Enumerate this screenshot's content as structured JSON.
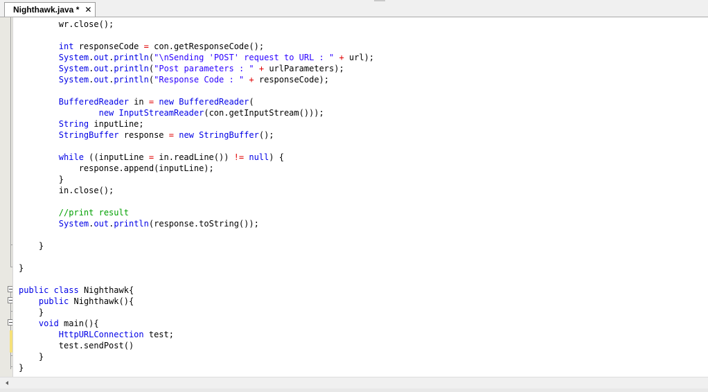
{
  "tab": {
    "label": "Nighthawk.java *",
    "close": "✕"
  },
  "code": [
    "        wr.close();",
    "",
    "        int responseCode = con.getResponseCode();",
    "        System.out.println(\"\\nSending 'POST' request to URL : \" + url);",
    "        System.out.println(\"Post parameters : \" + urlParameters);",
    "        System.out.println(\"Response Code : \" + responseCode);",
    "",
    "        BufferedReader in = new BufferedReader(",
    "                new InputStreamReader(con.getInputStream()));",
    "        String inputLine;",
    "        StringBuffer response = new StringBuffer();",
    "",
    "        while ((inputLine = in.readLine()) != null) {",
    "            response.append(inputLine);",
    "        }",
    "        in.close();",
    "",
    "        //print result",
    "        System.out.println(response.toString());",
    "",
    "    }",
    "",
    "}",
    "",
    "public class Nighthawk{",
    "    public Nighthawk(){",
    "    }",
    "    void main(){",
    "        HttpURLConnection test;",
    "        test.sendPost()",
    "    }",
    "}"
  ],
  "colors": {
    "keyword": "#0000e6",
    "string": "#2a00ff",
    "comment": "#00a000",
    "operator": "#e00000",
    "gutter": "#e9e8e2",
    "changed-line": "#f5e07a"
  }
}
